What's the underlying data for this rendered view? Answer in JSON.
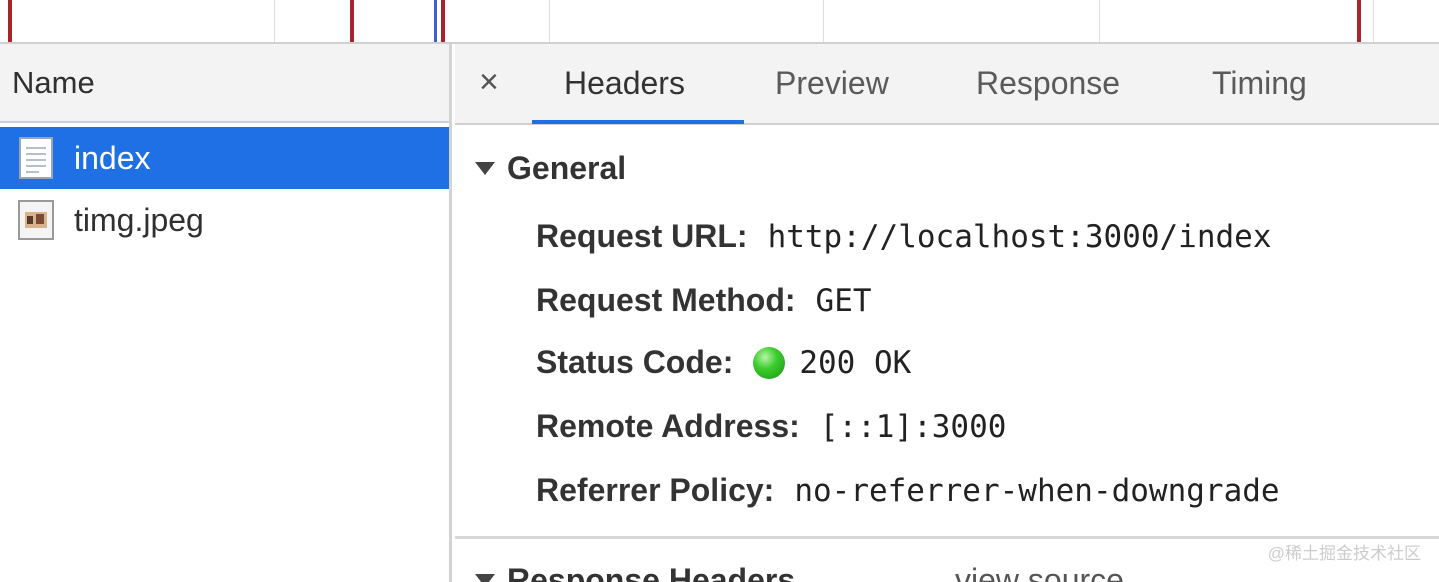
{
  "request_list": {
    "column_header": "Name",
    "rows": [
      {
        "name": "index",
        "icon": "document-icon",
        "selected": true
      },
      {
        "name": "timg.jpeg",
        "icon": "image-file-icon",
        "selected": false
      }
    ]
  },
  "detail": {
    "close_symbol": "×",
    "tabs": [
      {
        "label": "Headers",
        "active": true
      },
      {
        "label": "Preview",
        "active": false
      },
      {
        "label": "Response",
        "active": false
      },
      {
        "label": "Timing",
        "active": false
      }
    ],
    "general": {
      "title": "General",
      "fields": [
        {
          "key": "Request URL:",
          "value": "http://localhost:3000/index"
        },
        {
          "key": "Request Method:",
          "value": "GET"
        },
        {
          "key": "Status Code:",
          "value": "200 OK",
          "status_color": "#2fbf24"
        },
        {
          "key": "Remote Address:",
          "value": "[::1]:3000"
        },
        {
          "key": "Referrer Policy:",
          "value": "no-referrer-when-downgrade"
        }
      ]
    },
    "response_headers": {
      "title": "Response Headers",
      "view_source": "view source"
    }
  },
  "watermark": "@稀土掘金技术社区",
  "colors": {
    "selection": "#1f6fe5",
    "timeline_marker_red": "#a8242a",
    "timeline_marker_blue": "#3a63c8"
  }
}
